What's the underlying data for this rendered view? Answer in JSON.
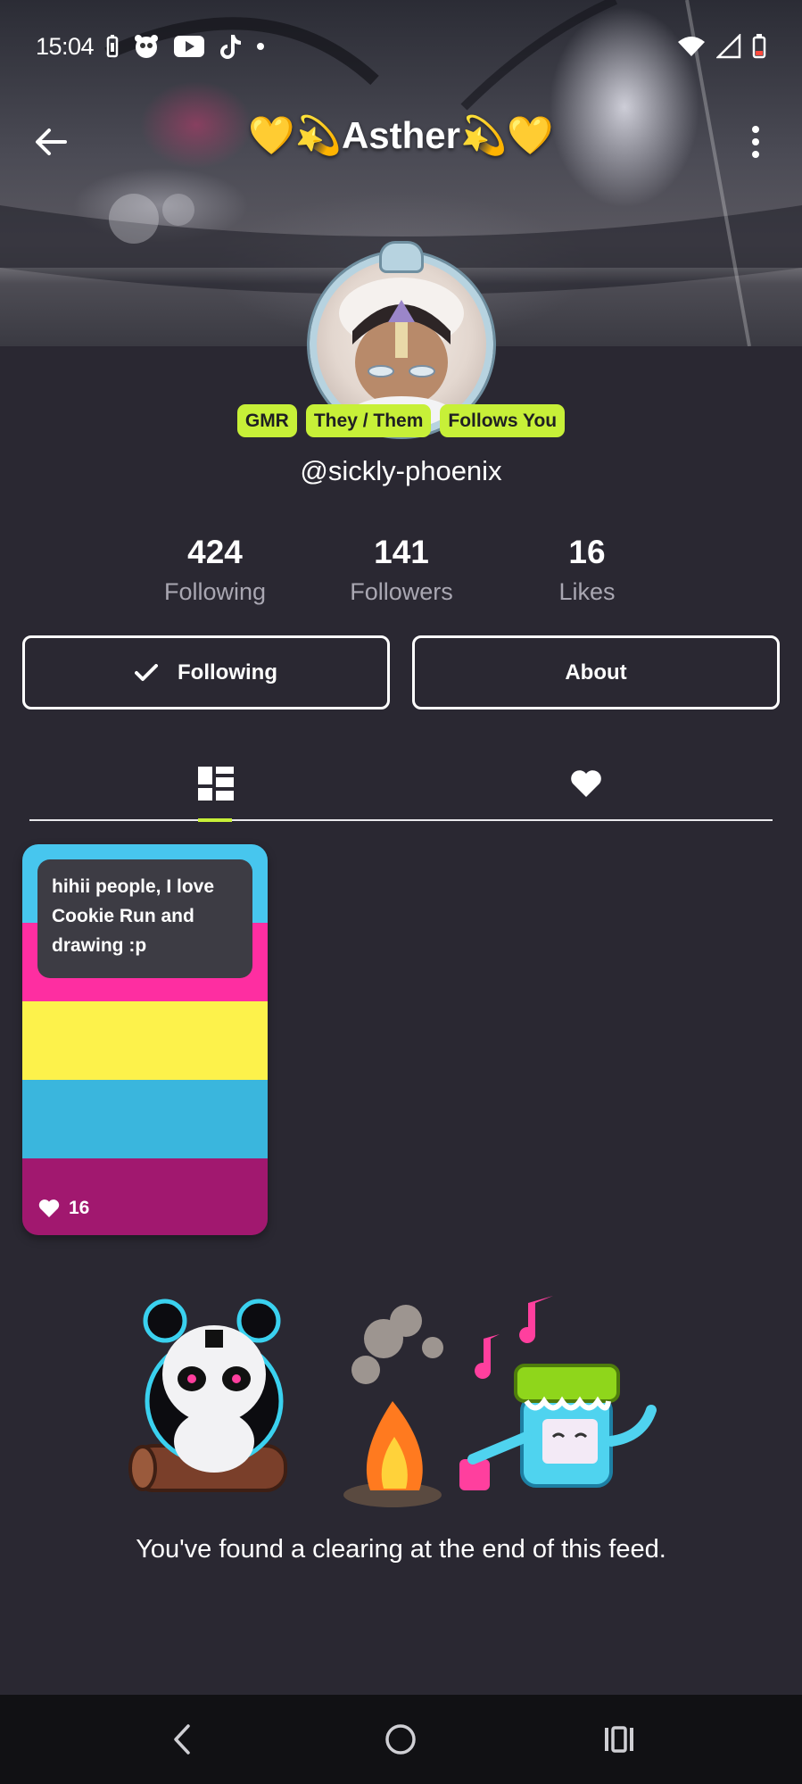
{
  "status_bar": {
    "time": "15:04",
    "left_icons": [
      "battery-saver-icon",
      "app-notification-icon",
      "youtube-icon",
      "tiktok-icon",
      "dot-icon"
    ],
    "right_icons": [
      "wifi-icon",
      "cellular-signal-icon",
      "battery-icon"
    ]
  },
  "header": {
    "title": "💛💫Asther💫💛",
    "back_icon": "arrow-left-icon",
    "more_icon": "more-vertical-icon"
  },
  "profile": {
    "badges": [
      "GMR",
      "They / Them",
      "Follows You"
    ],
    "handle": "@sickly-phoenix",
    "stats": [
      {
        "value": "424",
        "label": "Following"
      },
      {
        "value": "141",
        "label": "Followers"
      },
      {
        "value": "16",
        "label": "Likes"
      }
    ],
    "following_button": "Following",
    "about_button": "About"
  },
  "tabs": {
    "posts_icon": "grid-dashboard-icon",
    "likes_icon": "heart-icon",
    "active": "posts"
  },
  "post": {
    "text": "hihii people, I love Cookie Run and drawing :p",
    "likes": "16",
    "stripe_colors": [
      "#47c6ee",
      "#fe2ea1",
      "#fdf24b",
      "#3ab6dd",
      "#a1186f"
    ]
  },
  "feed_end": {
    "message": "You've found a clearing at the end of this feed."
  },
  "accent_color": "#c7f038",
  "nav_bar": {
    "icons": [
      "nav-back-icon",
      "nav-home-icon",
      "nav-recents-icon"
    ]
  }
}
